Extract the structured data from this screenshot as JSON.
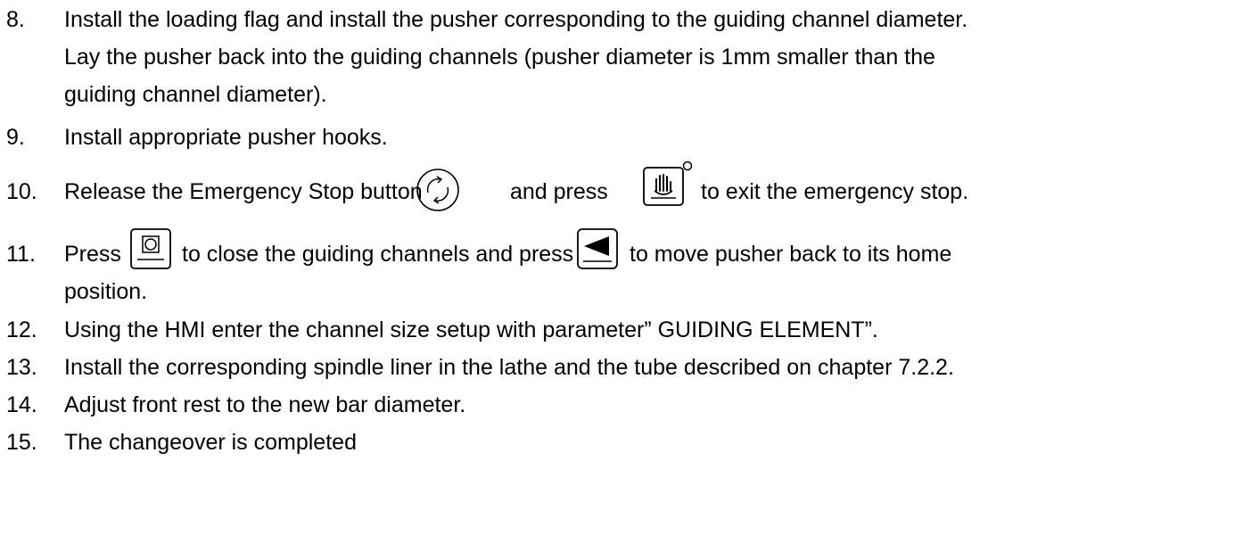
{
  "steps": [
    {
      "number": "8.",
      "lines": [
        "Install the loading flag and install the pusher corresponding to the guiding channel diameter.",
        "Lay the pusher back into the guiding channels (pusher diameter is 1mm smaller than the",
        "guiding channel diameter)."
      ]
    },
    {
      "number": "9.",
      "text": "Install appropriate pusher hooks."
    },
    {
      "number": "10.",
      "segments": [
        "Release the Emergency Stop button",
        "and press",
        "to exit the emergency stop."
      ],
      "icons": [
        "emergency-stop-release-icon",
        "hand-reset-icon"
      ]
    },
    {
      "number": "11.",
      "segments": [
        "Press",
        "to close the guiding channels and press",
        "to move pusher back to its home"
      ],
      "continuation": "position.",
      "icons": [
        "close-channels-icon",
        "pusher-back-arrow-icon"
      ]
    },
    {
      "number": "12.",
      "text": "Using the HMI enter the channel size setup with parameter” GUIDING ELEMENT”."
    },
    {
      "number": "13.",
      "text": "Install the corresponding spindle liner in the lathe and the tube described on chapter 7.2.2."
    },
    {
      "number": "14.",
      "text": "Adjust front rest to the new bar diameter."
    },
    {
      "number": "15.",
      "text": "The changeover is completed"
    }
  ]
}
